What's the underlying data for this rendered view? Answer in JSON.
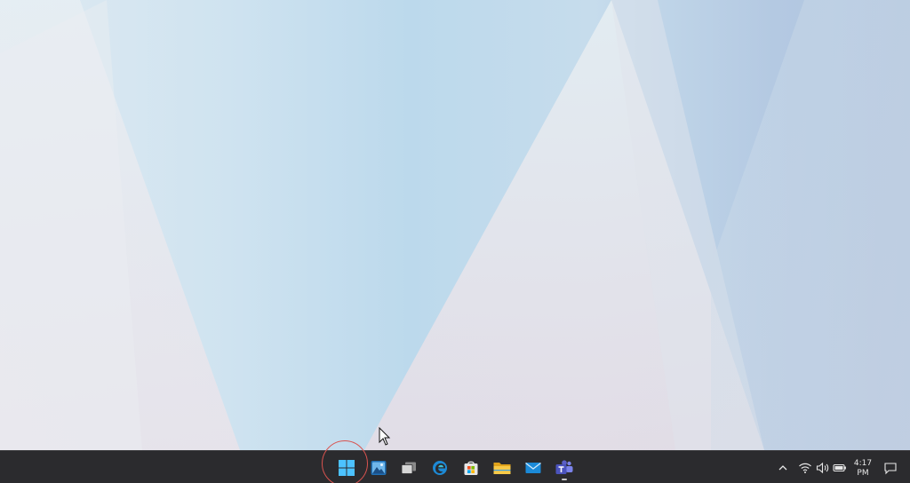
{
  "taskbar": {
    "apps": [
      {
        "name": "start",
        "icon": "windows-logo-icon"
      },
      {
        "name": "photos",
        "icon": "photos-icon"
      },
      {
        "name": "task-view",
        "icon": "task-view-icon"
      },
      {
        "name": "edge",
        "icon": "edge-browser-icon"
      },
      {
        "name": "store",
        "icon": "microsoft-store-icon"
      },
      {
        "name": "file-explorer",
        "icon": "folder-icon"
      },
      {
        "name": "mail",
        "icon": "mail-icon"
      },
      {
        "name": "teams",
        "icon": "teams-icon",
        "running": true
      }
    ],
    "tray": {
      "chevron_icon": "chevron-up-icon",
      "network_icon": "wifi-icon",
      "volume_icon": "speaker-icon",
      "battery_icon": "battery-icon",
      "clock_time": "4:17",
      "clock_date": "PM",
      "notification_icon": "notification-icon"
    }
  },
  "colors": {
    "taskbar_bg": "#2b2b2e",
    "start_blue": "#4cc2ff",
    "highlight_ring": "#d9534f",
    "wallpaper_light": "#dfeaf2",
    "wallpaper_blue": "#bcd9ec"
  }
}
